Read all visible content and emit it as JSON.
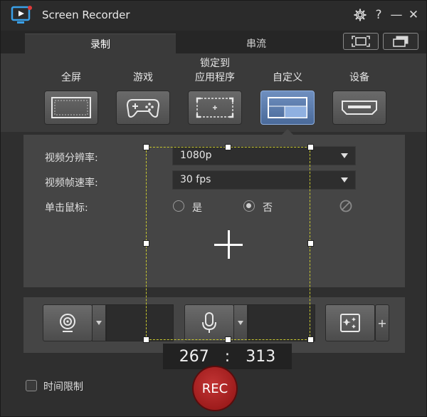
{
  "app": {
    "title": "Screen Recorder"
  },
  "titlebar": {
    "settings_icon": "gear-icon",
    "help_label": "?",
    "minimize_label": "—",
    "close_label": "✕"
  },
  "tabs": [
    {
      "label": "录制",
      "active": true
    },
    {
      "label": "串流",
      "active": false
    }
  ],
  "modes": [
    {
      "label": "全屏",
      "icon": "fullscreen-icon"
    },
    {
      "label": "游戏",
      "icon": "gamepad-icon"
    },
    {
      "label": "锁定到\n应用程序",
      "icon": "lock-app-icon"
    },
    {
      "label": "自定义",
      "icon": "custom-region-icon",
      "selected": true
    },
    {
      "label": "设备",
      "icon": "hdmi-device-icon"
    }
  ],
  "settings": {
    "resolution_label": "视频分辨率:",
    "resolution_value": "1080p",
    "framerate_label": "视频帧速率:",
    "framerate_value": "30 fps",
    "mouseclick_label": "单击鼠标:",
    "mouseclick_yes": "是",
    "mouseclick_no": "否",
    "mouseclick_selected": "否"
  },
  "devices": {
    "webcam_icon": "webcam-icon",
    "mic_icon": "microphone-icon",
    "effects_icon": "sparkle-effects-icon",
    "add_label": "+"
  },
  "region": {
    "width": "267",
    "separator": ":",
    "height": "313"
  },
  "bottom": {
    "time_limit_label": "时间限制",
    "time_limit_checked": false,
    "rec_label": "REC"
  },
  "colors": {
    "accent_blue": "#5a7aaa",
    "region_border": "#c9c92e",
    "rec_red": "#b02020"
  }
}
